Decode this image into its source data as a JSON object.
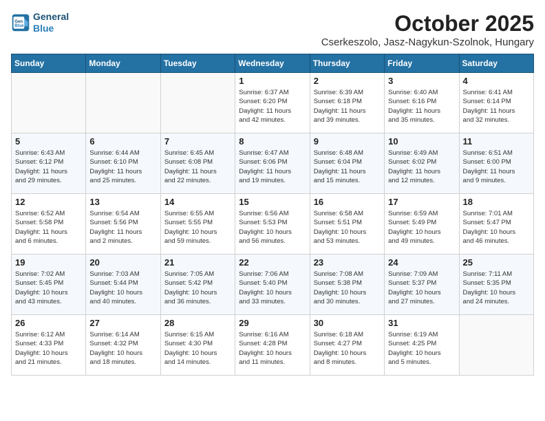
{
  "header": {
    "logo_line1": "General",
    "logo_line2": "Blue",
    "month": "October 2025",
    "location": "Cserkeszolo, Jasz-Nagykun-Szolnok, Hungary"
  },
  "weekdays": [
    "Sunday",
    "Monday",
    "Tuesday",
    "Wednesday",
    "Thursday",
    "Friday",
    "Saturday"
  ],
  "weeks": [
    [
      {
        "day": "",
        "info": ""
      },
      {
        "day": "",
        "info": ""
      },
      {
        "day": "",
        "info": ""
      },
      {
        "day": "1",
        "info": "Sunrise: 6:37 AM\nSunset: 6:20 PM\nDaylight: 11 hours\nand 42 minutes."
      },
      {
        "day": "2",
        "info": "Sunrise: 6:39 AM\nSunset: 6:18 PM\nDaylight: 11 hours\nand 39 minutes."
      },
      {
        "day": "3",
        "info": "Sunrise: 6:40 AM\nSunset: 6:16 PM\nDaylight: 11 hours\nand 35 minutes."
      },
      {
        "day": "4",
        "info": "Sunrise: 6:41 AM\nSunset: 6:14 PM\nDaylight: 11 hours\nand 32 minutes."
      }
    ],
    [
      {
        "day": "5",
        "info": "Sunrise: 6:43 AM\nSunset: 6:12 PM\nDaylight: 11 hours\nand 29 minutes."
      },
      {
        "day": "6",
        "info": "Sunrise: 6:44 AM\nSunset: 6:10 PM\nDaylight: 11 hours\nand 25 minutes."
      },
      {
        "day": "7",
        "info": "Sunrise: 6:45 AM\nSunset: 6:08 PM\nDaylight: 11 hours\nand 22 minutes."
      },
      {
        "day": "8",
        "info": "Sunrise: 6:47 AM\nSunset: 6:06 PM\nDaylight: 11 hours\nand 19 minutes."
      },
      {
        "day": "9",
        "info": "Sunrise: 6:48 AM\nSunset: 6:04 PM\nDaylight: 11 hours\nand 15 minutes."
      },
      {
        "day": "10",
        "info": "Sunrise: 6:49 AM\nSunset: 6:02 PM\nDaylight: 11 hours\nand 12 minutes."
      },
      {
        "day": "11",
        "info": "Sunrise: 6:51 AM\nSunset: 6:00 PM\nDaylight: 11 hours\nand 9 minutes."
      }
    ],
    [
      {
        "day": "12",
        "info": "Sunrise: 6:52 AM\nSunset: 5:58 PM\nDaylight: 11 hours\nand 6 minutes."
      },
      {
        "day": "13",
        "info": "Sunrise: 6:54 AM\nSunset: 5:56 PM\nDaylight: 11 hours\nand 2 minutes."
      },
      {
        "day": "14",
        "info": "Sunrise: 6:55 AM\nSunset: 5:55 PM\nDaylight: 10 hours\nand 59 minutes."
      },
      {
        "day": "15",
        "info": "Sunrise: 6:56 AM\nSunset: 5:53 PM\nDaylight: 10 hours\nand 56 minutes."
      },
      {
        "day": "16",
        "info": "Sunrise: 6:58 AM\nSunset: 5:51 PM\nDaylight: 10 hours\nand 53 minutes."
      },
      {
        "day": "17",
        "info": "Sunrise: 6:59 AM\nSunset: 5:49 PM\nDaylight: 10 hours\nand 49 minutes."
      },
      {
        "day": "18",
        "info": "Sunrise: 7:01 AM\nSunset: 5:47 PM\nDaylight: 10 hours\nand 46 minutes."
      }
    ],
    [
      {
        "day": "19",
        "info": "Sunrise: 7:02 AM\nSunset: 5:45 PM\nDaylight: 10 hours\nand 43 minutes."
      },
      {
        "day": "20",
        "info": "Sunrise: 7:03 AM\nSunset: 5:44 PM\nDaylight: 10 hours\nand 40 minutes."
      },
      {
        "day": "21",
        "info": "Sunrise: 7:05 AM\nSunset: 5:42 PM\nDaylight: 10 hours\nand 36 minutes."
      },
      {
        "day": "22",
        "info": "Sunrise: 7:06 AM\nSunset: 5:40 PM\nDaylight: 10 hours\nand 33 minutes."
      },
      {
        "day": "23",
        "info": "Sunrise: 7:08 AM\nSunset: 5:38 PM\nDaylight: 10 hours\nand 30 minutes."
      },
      {
        "day": "24",
        "info": "Sunrise: 7:09 AM\nSunset: 5:37 PM\nDaylight: 10 hours\nand 27 minutes."
      },
      {
        "day": "25",
        "info": "Sunrise: 7:11 AM\nSunset: 5:35 PM\nDaylight: 10 hours\nand 24 minutes."
      }
    ],
    [
      {
        "day": "26",
        "info": "Sunrise: 6:12 AM\nSunset: 4:33 PM\nDaylight: 10 hours\nand 21 minutes."
      },
      {
        "day": "27",
        "info": "Sunrise: 6:14 AM\nSunset: 4:32 PM\nDaylight: 10 hours\nand 18 minutes."
      },
      {
        "day": "28",
        "info": "Sunrise: 6:15 AM\nSunset: 4:30 PM\nDaylight: 10 hours\nand 14 minutes."
      },
      {
        "day": "29",
        "info": "Sunrise: 6:16 AM\nSunset: 4:28 PM\nDaylight: 10 hours\nand 11 minutes."
      },
      {
        "day": "30",
        "info": "Sunrise: 6:18 AM\nSunset: 4:27 PM\nDaylight: 10 hours\nand 8 minutes."
      },
      {
        "day": "31",
        "info": "Sunrise: 6:19 AM\nSunset: 4:25 PM\nDaylight: 10 hours\nand 5 minutes."
      },
      {
        "day": "",
        "info": ""
      }
    ]
  ]
}
